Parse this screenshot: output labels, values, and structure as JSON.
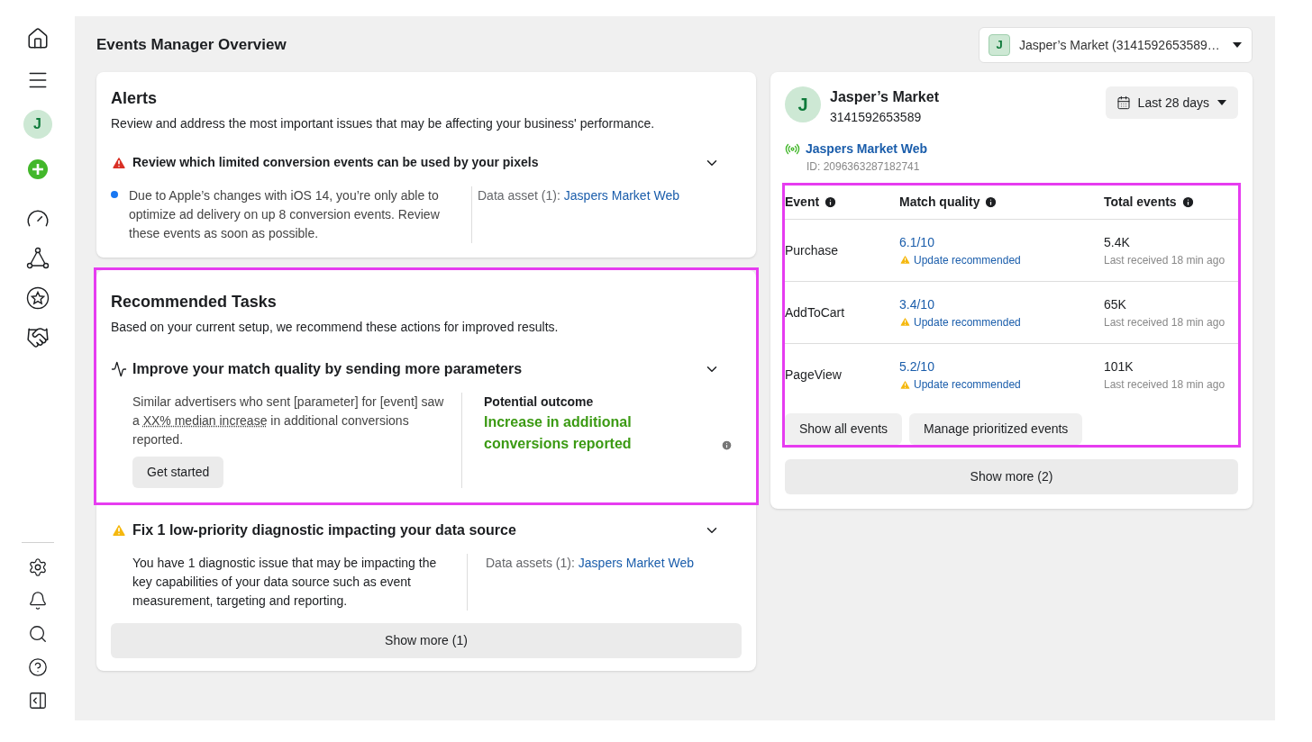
{
  "sidebar": {
    "avatar_letter": "J"
  },
  "header": {
    "title": "Events Manager Overview",
    "account_selector": {
      "letter": "J",
      "label": "Jasper’s Market (3141592653589…"
    }
  },
  "alerts": {
    "title": "Alerts",
    "description": "Review and address the most important issues that may be affecting your business' performance.",
    "items": [
      {
        "kind": "error",
        "title": "Review which limited conversion events can be used by your pixels",
        "expanded": true,
        "body": "Due to Apple’s changes with iOS 14, you’re only able to optimize ad delivery on up 8 conversion events. Review these events as soon as possible.",
        "unread": true,
        "asset_label": "Data asset (1):",
        "asset_link": "Jaspers Market Web"
      }
    ]
  },
  "recommended_tasks": {
    "title": "Recommended Tasks",
    "highlighted": true,
    "description": "Based on your current setup, we recommend these actions for improved results.",
    "task": {
      "title": "Improve your match quality by sending more parameters",
      "expanded": true,
      "body_before": "Similar advertisers who sent [parameter] for [event] saw a",
      "body_link": "XX% median increase",
      "body_after": "in additional conversions reported.",
      "button": "Get started",
      "outcome_label": "Potential outcome",
      "outcome": "Increase in additional conversions reported"
    }
  },
  "diagnostics": {
    "kind": "warning",
    "title": "Fix 1 low-priority diagnostic impacting your data source",
    "expanded": true,
    "body": "You have 1 diagnostic issue that may be impacting the key capabilities of your data source such as event measurement, targeting and reporting.",
    "asset_label": "Data assets (1):",
    "asset_link": "Jaspers Market Web",
    "show_more": "Show more (1)"
  },
  "account": {
    "letter": "J",
    "name": "Jasper’s Market",
    "id": "3141592653589",
    "date_range": "Last 28 days",
    "pixel_name": "Jaspers Market Web",
    "pixel_id": "ID: 2096363287182741"
  },
  "events_table": {
    "highlighted": true,
    "columns": [
      "Event",
      "Match quality",
      "Total events"
    ],
    "rows": [
      {
        "event": "Purchase",
        "score": "6.1/10",
        "status": "Update recommended",
        "total": "5.4K",
        "last_received": "Last received 18 min ago"
      },
      {
        "event": "AddToCart",
        "score": "3.4/10",
        "status": "Update recommended",
        "total": "65K",
        "last_received": "Last received 18 min ago"
      },
      {
        "event": "PageView",
        "score": "5.2/10",
        "status": "Update recommended",
        "total": "101K",
        "last_received": "Last received 18 min ago"
      }
    ],
    "buttons": [
      "Show all events",
      "Manage prioritized events"
    ]
  },
  "show_more": "Show more (2)"
}
